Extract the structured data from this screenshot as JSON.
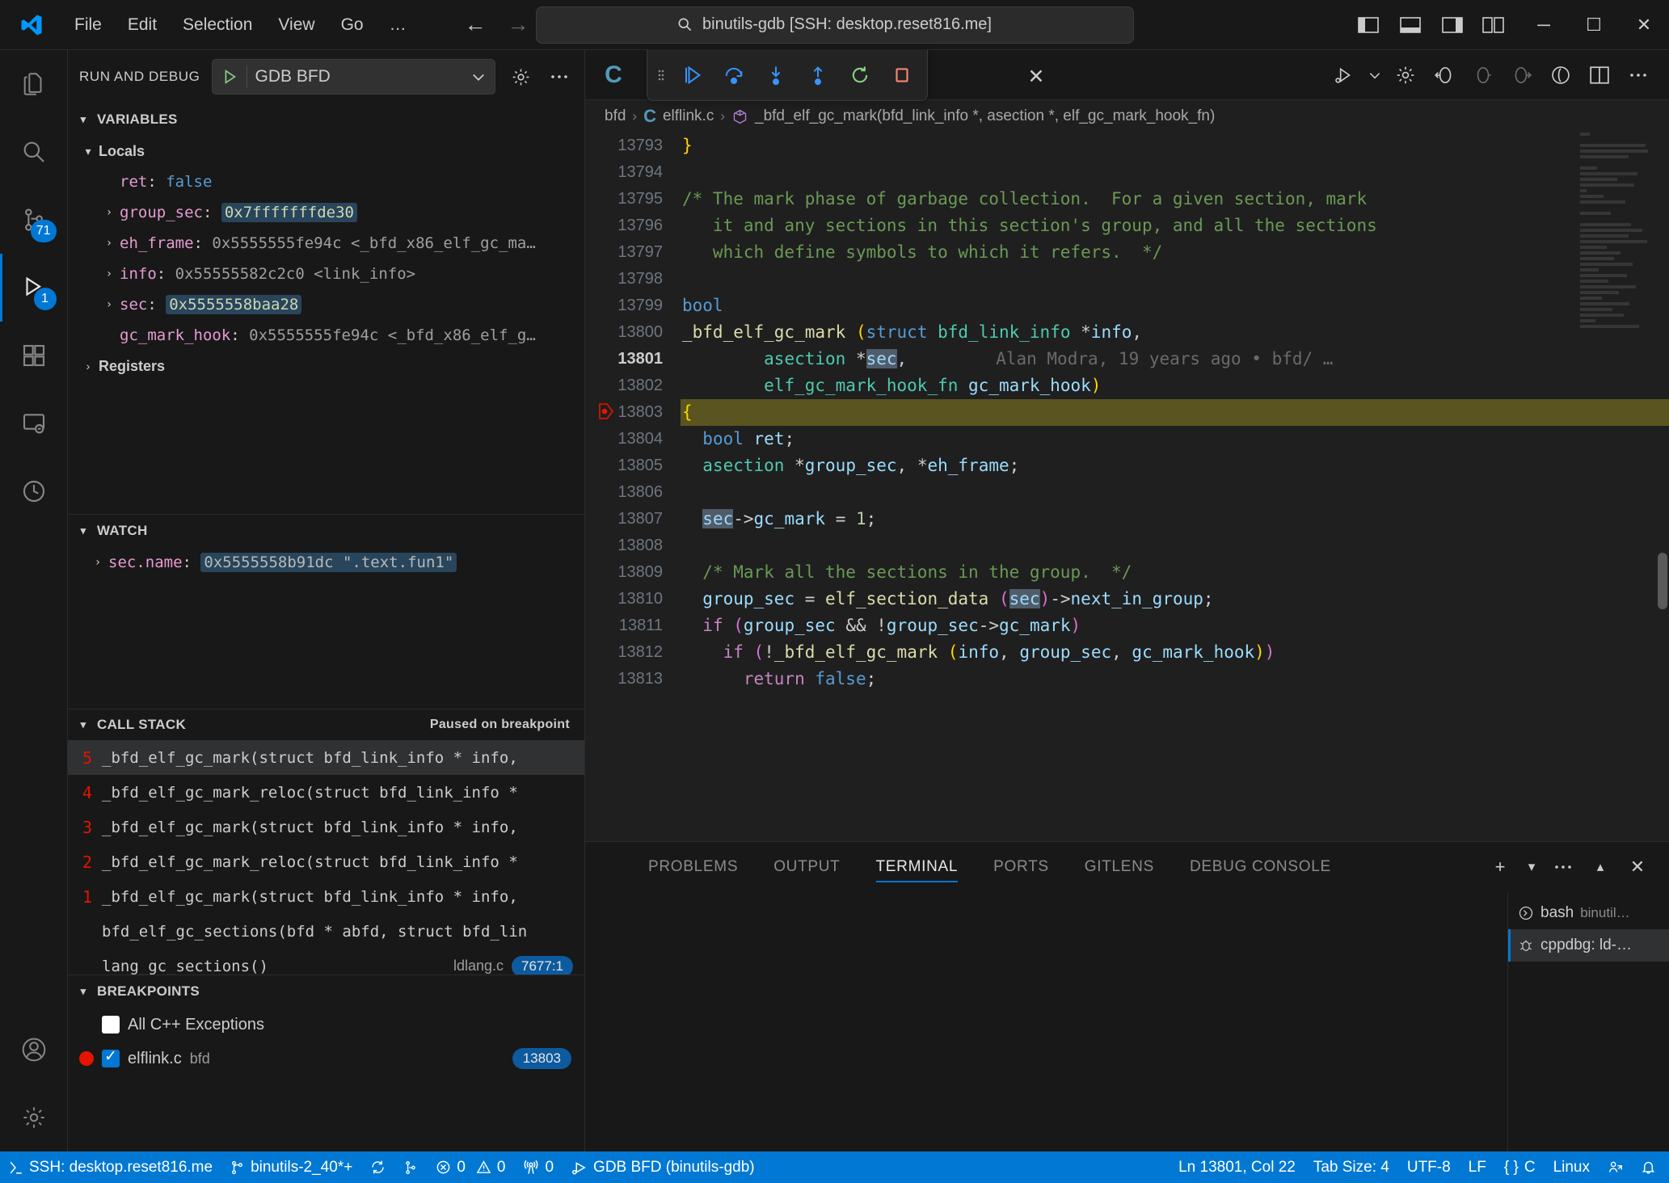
{
  "window": {
    "search_placeholder": "binutils-gdb [SSH: desktop.reset816.me]",
    "menu": [
      "File",
      "Edit",
      "Selection",
      "View",
      "Go",
      "…"
    ],
    "back_icon": "arrow-left-icon",
    "forward_icon": "arrow-right-icon",
    "search_icon": "search-icon",
    "layout_icons": [
      "toggle-primary-sidebar-icon",
      "toggle-panel-icon",
      "toggle-secondary-sidebar-icon",
      "customize-layout-icon"
    ],
    "minimize": "─",
    "maximize": "☐",
    "close": "✕"
  },
  "activitybar": {
    "items": [
      {
        "name": "explorer",
        "icon": "files-icon",
        "badge": ""
      },
      {
        "name": "search",
        "icon": "search-icon",
        "badge": ""
      },
      {
        "name": "source-control",
        "icon": "source-control-icon",
        "badge": "71"
      },
      {
        "name": "run-and-debug",
        "icon": "run-and-debug-icon",
        "badge": "1"
      },
      {
        "name": "extensions",
        "icon": "extensions-icon",
        "badge": ""
      },
      {
        "name": "remote-explorer",
        "icon": "remote-explorer-icon",
        "badge": ""
      },
      {
        "name": "testing",
        "icon": "beaker-icon",
        "badge": ""
      }
    ],
    "bottom": [
      {
        "name": "accounts",
        "icon": "account-icon"
      },
      {
        "name": "settings",
        "icon": "gear-icon"
      }
    ]
  },
  "sidebar": {
    "title": "RUN AND DEBUG",
    "config": "GDB BFD",
    "config_play_icon": "play-icon",
    "config_chevron": "chevron-down-icon",
    "gear_icon": "gear-icon",
    "more_icon": "ellipsis-icon",
    "variables": {
      "title": "VARIABLES",
      "groups": [
        {
          "label": "Locals",
          "expanded": true
        }
      ],
      "items": [
        {
          "name": "ret",
          "value": "false",
          "kind": "bool",
          "expandable": false,
          "highlight": "none"
        },
        {
          "name": "group_sec",
          "value": "0x7fffffffde30",
          "kind": "ptr",
          "expandable": true,
          "highlight": "changed"
        },
        {
          "name": "eh_frame",
          "value": "0x5555555fe94c <_bfd_x86_elf_gc_ma…",
          "kind": "ptr",
          "expandable": true,
          "highlight": "none"
        },
        {
          "name": "info",
          "value": "0x55555582c2c0 <link_info>",
          "kind": "ptr",
          "expandable": true,
          "highlight": "none"
        },
        {
          "name": "sec",
          "value": "0x5555558baa28",
          "kind": "ptr",
          "expandable": true,
          "highlight": "changed"
        },
        {
          "name": "gc_mark_hook",
          "value": "0x5555555fe94c <_bfd_x86_elf_g…",
          "kind": "ptr",
          "expandable": false,
          "highlight": "none"
        }
      ],
      "registers_label": "Registers"
    },
    "watch": {
      "title": "WATCH",
      "items": [
        {
          "name": "sec.name",
          "value": "0x5555558b91dc \".text.fun1\"",
          "expandable": true,
          "highlight": "changed"
        }
      ]
    },
    "callstack": {
      "title": "CALL STACK",
      "status": "Paused on breakpoint",
      "frames": [
        {
          "num": "5",
          "label": "_bfd_elf_gc_mark(struct bfd_link_info * info,",
          "file": "",
          "badge": "",
          "selected": true
        },
        {
          "num": "4",
          "label": "_bfd_elf_gc_mark_reloc(struct bfd_link_info *",
          "file": "",
          "badge": "",
          "selected": false
        },
        {
          "num": "3",
          "label": "_bfd_elf_gc_mark(struct bfd_link_info * info,",
          "file": "",
          "badge": "",
          "selected": false
        },
        {
          "num": "2",
          "label": "_bfd_elf_gc_mark_reloc(struct bfd_link_info *",
          "file": "",
          "badge": "",
          "selected": false
        },
        {
          "num": "1",
          "label": "_bfd_elf_gc_mark(struct bfd_link_info * info,",
          "file": "",
          "badge": "",
          "selected": false
        },
        {
          "num": "",
          "label": "bfd_elf_gc_sections(bfd * abfd, struct bfd_lin",
          "file": "",
          "badge": "",
          "selected": false
        },
        {
          "num": "",
          "label": "lang_gc_sections()",
          "file": "ldlang.c",
          "badge": "7677:1",
          "selected": false
        }
      ]
    },
    "breakpoints": {
      "title": "BREAKPOINTS",
      "items": [
        {
          "name": "All C++ Exceptions",
          "sub": "",
          "checked": false,
          "dot": false,
          "badge": ""
        },
        {
          "name": "elflink.c",
          "sub": "bfd",
          "checked": true,
          "dot": true,
          "badge": "13803"
        }
      ]
    }
  },
  "editor": {
    "file_icon": "c-file-icon",
    "close_icon": "close-icon",
    "debug_toolbar": [
      {
        "name": "drag-handle",
        "icon": "grip-icon"
      },
      {
        "name": "continue",
        "icon": "continue-icon"
      },
      {
        "name": "step-over",
        "icon": "step-over-icon"
      },
      {
        "name": "step-into",
        "icon": "step-into-icon"
      },
      {
        "name": "step-out",
        "icon": "step-out-icon"
      },
      {
        "name": "restart",
        "icon": "restart-icon"
      },
      {
        "name": "stop",
        "icon": "stop-icon"
      }
    ],
    "editor_actions": [
      {
        "name": "run-or-debug",
        "icon": "run-debug-icon"
      },
      {
        "name": "run-chevron",
        "icon": "chevron-down-icon"
      },
      {
        "name": "settings",
        "icon": "gear-icon"
      },
      {
        "name": "gitlens-back",
        "icon": "gitlens-back-icon"
      },
      {
        "name": "gitlens-prev",
        "icon": "gitlens-prev-icon"
      },
      {
        "name": "gitlens-next",
        "icon": "gitlens-next-icon"
      },
      {
        "name": "gitlens-blame",
        "icon": "gitlens-blame-icon"
      },
      {
        "name": "split-editor",
        "icon": "split-editor-icon"
      },
      {
        "name": "more-actions",
        "icon": "ellipsis-icon"
      }
    ],
    "breadcrumb": [
      "bfd",
      "elflink.c",
      "_bfd_elf_gc_mark(bfd_link_info *, asection *, elf_gc_mark_hook_fn)"
    ],
    "blame_annotation": "Alan Modra, 19 years ago • bfd/ …",
    "lines": [
      {
        "n": "13793",
        "html": "<span class='t-par'>}</span>"
      },
      {
        "n": "13794",
        "html": ""
      },
      {
        "n": "13795",
        "html": "<span class='t-cmt'>/* The mark phase of garbage collection.  For a given section, mark</span>"
      },
      {
        "n": "13796",
        "html": "<span class='t-cmt'>   it and any sections in this section's group, and all the sections</span>"
      },
      {
        "n": "13797",
        "html": "<span class='t-cmt'>   which define symbols to which it refers.  */</span>"
      },
      {
        "n": "13798",
        "html": ""
      },
      {
        "n": "13799",
        "html": "<span class='t-kw'>bool</span>"
      },
      {
        "n": "13800",
        "html": "<span class='t-fn'>_bfd_elf_gc_mark</span> <span class='t-par'>(</span><span class='t-kw'>struct</span> <span class='t-type'>bfd_link_info</span> *<span class='t-var'>info</span>,"
      },
      {
        "n": "13801",
        "html": "        <span class='t-type'>asection</span> *<span class='t-var occ'>sec</span>,"
      },
      {
        "n": "13802",
        "html": "        <span class='t-type'>elf_gc_mark_hook_fn</span> <span class='t-var'>gc_mark_hook</span><span class='t-par'>)</span>"
      },
      {
        "n": "13803",
        "html": "<span class='t-par'>{</span>"
      },
      {
        "n": "13804",
        "html": "  <span class='t-kw'>bool</span> <span class='t-var'>ret</span>;"
      },
      {
        "n": "13805",
        "html": "  <span class='t-type'>asection</span> *<span class='t-var'>group_sec</span>, *<span class='t-var'>eh_frame</span>;"
      },
      {
        "n": "13806",
        "html": ""
      },
      {
        "n": "13807",
        "html": "  <span class='t-var occ'>sec</span>-&gt;<span class='t-var'>gc_mark</span> = <span class='t-num'>1</span>;"
      },
      {
        "n": "13808",
        "html": ""
      },
      {
        "n": "13809",
        "html": "  <span class='t-cmt'>/* Mark all the sections in the group.  */</span>"
      },
      {
        "n": "13810",
        "html": "  <span class='t-var'>group_sec</span> = <span class='t-fn2'>elf_section_data</span> <span class='t-par2'>(</span><span class='t-var occ'>sec</span><span class='t-par2'>)</span>-&gt;<span class='t-var'>next_in_group</span>;"
      },
      {
        "n": "13811",
        "html": "  <span class='t-ctl'>if</span> <span class='t-par2'>(</span><span class='t-var'>group_sec</span> &amp;&amp; !<span class='t-var'>group_sec</span>-&gt;<span class='t-var'>gc_mark</span><span class='t-par2'>)</span>"
      },
      {
        "n": "13812",
        "html": "    <span class='t-ctl'>if</span> <span class='t-par2'>(</span>!<span class='t-fn2'>_bfd_elf_gc_mark</span> <span class='t-par'>(</span><span class='t-var'>info</span>, <span class='t-var'>group_sec</span>, <span class='t-var'>gc_mark_hook</span><span class='t-par'>)</span><span class='t-par2'>)</span>"
      },
      {
        "n": "13813",
        "html": "      <span class='t-ctl'>return</span> <span class='t-kw'>false</span>;"
      }
    ],
    "current_line": "13801",
    "breakpoint_line": "13803",
    "highlight_line": "13803"
  },
  "panel": {
    "tabs": [
      {
        "label": "PROBLEMS",
        "active": false
      },
      {
        "label": "OUTPUT",
        "active": false
      },
      {
        "label": "TERMINAL",
        "active": true
      },
      {
        "label": "PORTS",
        "active": false
      },
      {
        "label": "GITLENS",
        "active": false
      },
      {
        "label": "DEBUG CONSOLE",
        "active": false
      }
    ],
    "actions": [
      {
        "name": "new-terminal",
        "icon": "plus-icon"
      },
      {
        "name": "terminal-dropdown",
        "icon": "chevron-down-icon"
      },
      {
        "name": "panel-more",
        "icon": "ellipsis-icon"
      },
      {
        "name": "maximize-panel",
        "icon": "chevron-up-icon"
      },
      {
        "name": "close-panel",
        "icon": "close-icon"
      }
    ],
    "terminals": [
      {
        "name": "bash",
        "sub": "binutil…",
        "icon": "terminal-bash-icon",
        "selected": false
      },
      {
        "name": "cppdbg: ld-…",
        "sub": "",
        "icon": "debug-icon",
        "selected": true
      }
    ]
  },
  "statusbar": {
    "left": [
      {
        "name": "remote-host",
        "icon": "remote-icon",
        "label": "SSH: desktop.reset816.me"
      },
      {
        "name": "git-branch",
        "icon": "branch-icon",
        "label": "binutils-2_40*+"
      },
      {
        "name": "sync-changes",
        "icon": "sync-icon",
        "label": ""
      },
      {
        "name": "git-actions",
        "icon": "branch-small-icon",
        "label": ""
      },
      {
        "name": "problems",
        "icon": "error-warning-icon",
        "label": "0  0",
        "errors": "0",
        "warnings": "0"
      },
      {
        "name": "ports-forwarded",
        "icon": "radio-tower-icon",
        "label": "0"
      },
      {
        "name": "debug-session",
        "icon": "debug-alt-icon",
        "label": "GDB BFD (binutils-gdb)"
      }
    ],
    "right": [
      {
        "name": "cursor-position",
        "label": "Ln 13801, Col 22"
      },
      {
        "name": "tab-size",
        "label": "Tab Size: 4"
      },
      {
        "name": "encoding",
        "label": "UTF-8"
      },
      {
        "name": "eol",
        "label": "LF"
      },
      {
        "name": "language-mode",
        "label": "C",
        "icon": "braces-icon"
      },
      {
        "name": "platform",
        "label": "Linux"
      },
      {
        "name": "live-share",
        "icon": "live-share-icon",
        "label": ""
      },
      {
        "name": "notifications",
        "icon": "bell-icon",
        "label": ""
      }
    ]
  },
  "colors": {
    "accent": "#0078d4",
    "breakpoint_red": "#e51400",
    "play_green": "#89d185",
    "highlight_line": "#5a5420"
  }
}
